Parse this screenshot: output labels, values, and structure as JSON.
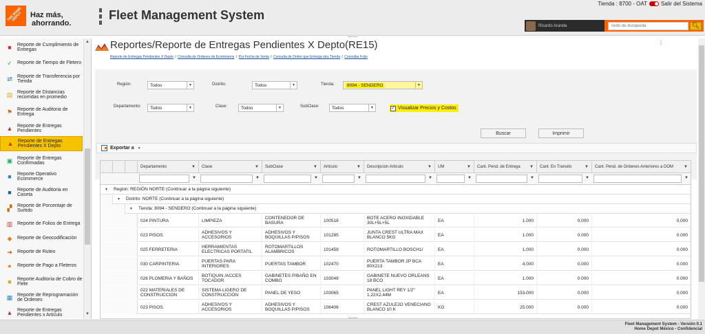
{
  "header": {
    "tagline_line1": "Haz más,",
    "tagline_line2": "ahorrando.",
    "logo_text": "THE HOME DEPOT",
    "app_title": "Fleet Management System",
    "store_label": "Tienda : 8700 - OAT",
    "exit_label": "Salir del Sistema",
    "user_name": "Ricardo Aranda",
    "search_placeholder": "Texto de Busqueda"
  },
  "sidebar": {
    "items": [
      {
        "label": "Reporte de Cumplimiento de Entregas",
        "icon": "truck-icon",
        "color": "#c0392b"
      },
      {
        "label": "Reporte de Tiempo de Fletero",
        "icon": "check-icon",
        "color": "#27ae60"
      },
      {
        "label": "Reporte de Transferencia por Tienda",
        "icon": "transfer-icon",
        "color": "#2e86c1"
      },
      {
        "label": "Reporte de Distancias recorridas en promedio",
        "icon": "document-icon",
        "color": "#d4ac0d"
      },
      {
        "label": "Reporte de Auditoria de Entrega",
        "icon": "audit-icon",
        "color": "#ca6f1e"
      },
      {
        "label": "Reporte de Entregas Pendientes",
        "icon": "chart-icon",
        "color": "#c0392b"
      },
      {
        "label": "Reporte de Entregas Pendientes X Depto",
        "icon": "chart-icon",
        "color": "#c0392b",
        "active": true
      },
      {
        "label": "Reporte de Entregas Confirmadas",
        "icon": "box-check-icon",
        "color": "#27ae60"
      },
      {
        "label": "Reporte Operativo Ecommerce",
        "icon": "truck-icon",
        "color": "#2e86c1"
      },
      {
        "label": "Reporte de Auditoria en Caseta",
        "icon": "truck-icon",
        "color": "#1f618d"
      },
      {
        "label": "Reporte de Porcentaje de Surtido",
        "icon": "forklift-icon",
        "color": "#ca6f1e"
      },
      {
        "label": "Reporte de Folios de Entrega",
        "icon": "bars-icon",
        "color": "#c0392b"
      },
      {
        "label": "Reporte de Geocodificación",
        "icon": "map-icon",
        "color": "#e67e22"
      },
      {
        "label": "Reporte de Ruteo",
        "icon": "route-icon",
        "color": "#d35400"
      },
      {
        "label": "Reporte de Pago a Fleteros",
        "icon": "money-icon",
        "color": "#e67e22"
      },
      {
        "label": "Reporte Auditoria de Cobro de Flete",
        "icon": "truck-icon",
        "color": "#d4ac0d"
      },
      {
        "label": "Reporte de Reprogramación de Ordenes",
        "icon": "calendar-icon",
        "color": "#2e86c1"
      },
      {
        "label": "Reporte de Entregas Pendientes x Articulo",
        "icon": "chart-icon",
        "color": "#c0392b"
      }
    ]
  },
  "main": {
    "page_title": "Reportes/Reporte de Entregas Pendientes X Depto(RE15)",
    "dots": "⋮",
    "breadcrumb": [
      "Reporte de Entregas Pendientes X Depto",
      "Consulta de Ordenes de Ecommerce",
      "Por Fecha de Venta",
      "Consulta de Orden que Entrega otra Tienda",
      "Consultar Folio"
    ],
    "filters": {
      "region_label": "Región:",
      "region_value": "Todos",
      "distrito_label": "Distrito:",
      "distrito_value": "Todos",
      "tienda_label": "Tienda:",
      "tienda_value": "8094 - SENDERO",
      "departamento_label": "Departamento:",
      "departamento_value": "Todos",
      "clase_label": "Clase:",
      "clase_value": "Todos",
      "subclase_label": "SubClase:",
      "subclase_value": "Todos",
      "price_check_label": "Visualizar Precios y Costos"
    },
    "buttons": {
      "search": "Buscar",
      "print": "Imprimir"
    },
    "export_label": "Exportar a",
    "grid": {
      "columns": [
        "Departamento",
        "Clase",
        "SubClase",
        "Articulo",
        "Descripcion Articulo",
        "UM",
        "Cant. Pend. de Entrega",
        "Cant. En Transito",
        "Cant. Pend. de Ordenes Anteriores a DOM"
      ],
      "group_region": "Region: REGIÓN NORTE (Continuar a la página siguiente)",
      "group_distrito": "Distrito: NORTE (Continuar a la página siguiente)",
      "group_tienda": "Tienda: 8094 - SENDERO (Continuar a la página siguiente)",
      "rows": [
        [
          "024 PINTURA",
          "LIMPIEZA",
          "CONTENEDOR DE BASURA",
          "100518",
          "BOTE ACERO INOXIDABLE 30L+5L+5L",
          "EA",
          "1.000",
          "0.000",
          "0.000"
        ],
        [
          "023 PISOS.",
          "ADHESIVOS Y ACCESORIOS",
          "ADHESIVOS Y BOQUILLAS P/PISOS",
          "101285",
          "JUNTA CREST ULTRA MAX BLANCO 5KG",
          "EA",
          "1.000",
          "0.000",
          "0.000"
        ],
        [
          "025 FERRETERIA",
          "HERRAMIENTAS ELECTRICAS PORTATIL",
          "ROTOMARTILLOS ALAMBRICOS",
          "101459",
          "ROTOMARTILLO BOSCH1/",
          "EA",
          "1.000",
          "0.000",
          "0.000"
        ],
        [
          "030 CARPINTERIA",
          "PUERTAS PARA INTERIORES",
          "PUERTAS TAMBOR",
          "102470",
          "PUERTA TAMBOR 2P BCA 80X213",
          "EA",
          "4.000",
          "0.000",
          "0.000"
        ],
        [
          "026 PLOMERIA Y BAÑOS",
          "BOTIQUIN /ACCES TOCADOR",
          "GABINETES P/BAÑO EN COMBO",
          "103049",
          "GABINETE NUEVO ORLEANS 18 BCO",
          "EA",
          "1.000",
          "0.000",
          "0.000"
        ],
        [
          "022 MATERIALES DE CONSTRUCCION",
          "SISTEMA LIGERO DE CONSTRUCCIÓN",
          "PANEL DE YESO",
          "103065",
          "PANEL LIGHT REY 1/2\" 1.22X2.44M",
          "EA",
          "153.000",
          "0.000",
          "0.000"
        ],
        [
          "023 PISOS.",
          "ADHESIVOS Y ACCESORIOS",
          "ADHESIVOS Y BOQUILLAS P/PISOS",
          "106406",
          "CREST AZULEJO VENECIANO BLANCO 10 K",
          "KG",
          "25.000",
          "0.000",
          "0.000"
        ]
      ]
    }
  },
  "footer": {
    "version": "Fleet Management System - Versión 0.1",
    "company": "Home Depot México - Confidencial"
  },
  "colors": {
    "brand": "#f96302",
    "highlight": "#ffee00",
    "active_item": "#f5c300",
    "link": "#1a4f9c"
  }
}
